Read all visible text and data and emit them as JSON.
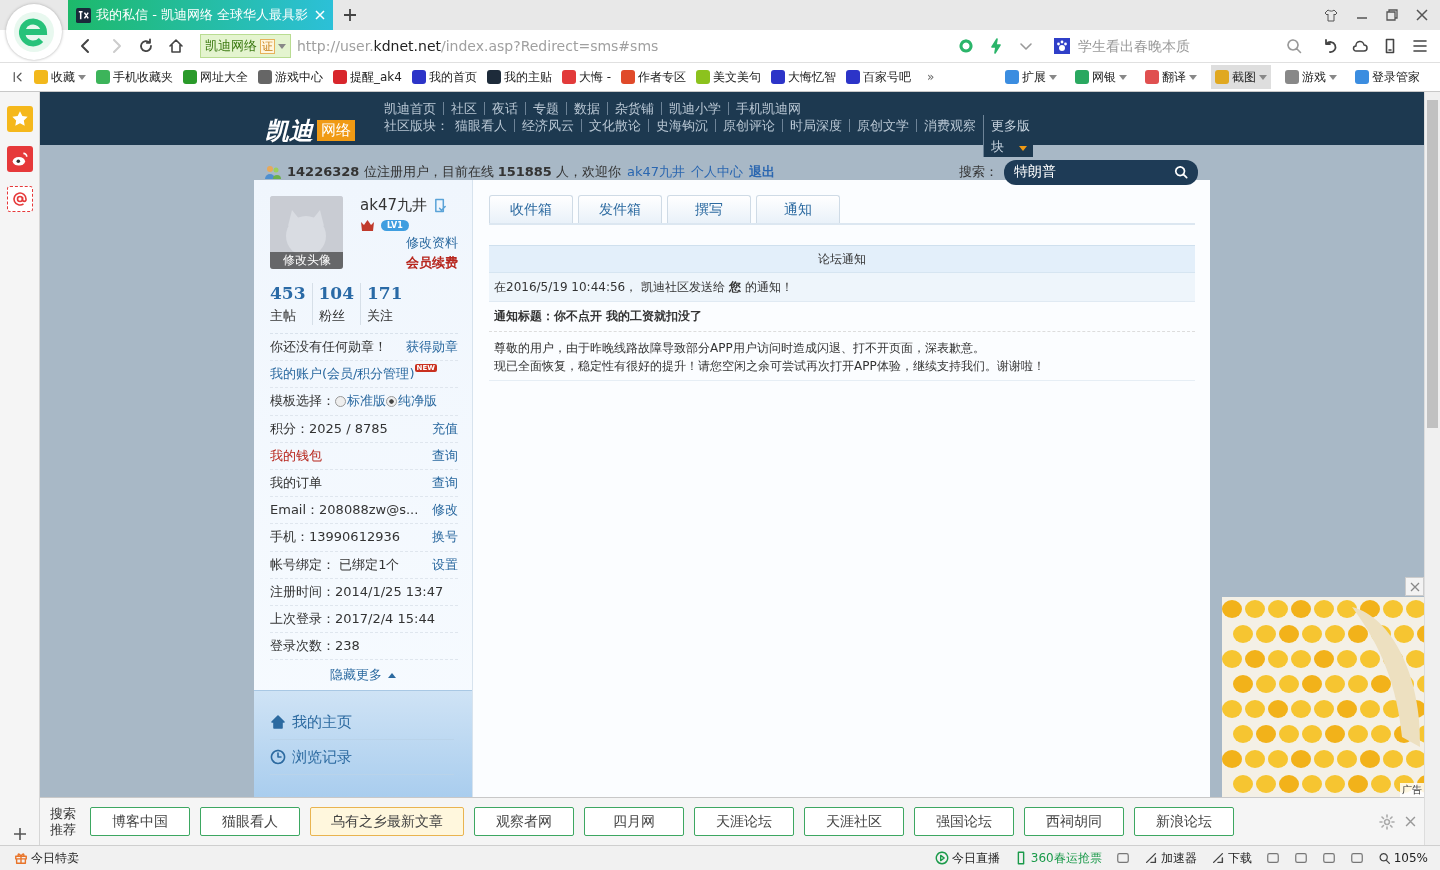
{
  "browser": {
    "tab": {
      "title": "我的私信 - 凯迪网络 全球华人最具影"
    },
    "address": {
      "site": "凯迪网络",
      "cert": "证",
      "url_prefix": "http://user.",
      "url_host": "kdnet.net",
      "url_path": "/index.asp?Redirect=sms#sms"
    },
    "search": {
      "placeholder": "学生看出春晚本质"
    },
    "bookmarks": [
      {
        "label": "收藏",
        "color": "#f2b81c",
        "caret": true
      },
      {
        "label": "手机收藏夹",
        "color": "#3cb45a",
        "caret": false
      },
      {
        "label": "网址大全",
        "color": "#2a9a2a",
        "caret": false
      },
      {
        "label": "游戏中心",
        "color": "#666666",
        "caret": false
      },
      {
        "label": "提醒_ak4",
        "color": "#d8262c",
        "caret": false
      },
      {
        "label": "我的首页",
        "color": "#2c34c8",
        "caret": false
      },
      {
        "label": "我的主贴",
        "color": "#1d2b3a",
        "caret": false
      },
      {
        "label": "大悔 -",
        "color": "#e23a3a",
        "caret": false
      },
      {
        "label": "作者专区",
        "color": "#e04a2a",
        "caret": false
      },
      {
        "label": "美文美句",
        "color": "#8cc21e",
        "caret": false
      },
      {
        "label": "大悔忆智",
        "color": "#2c34c8",
        "caret": false
      },
      {
        "label": "百家号吧",
        "color": "#2c34c8",
        "caret": false
      }
    ],
    "bookmarks_more": "»",
    "tools": [
      {
        "label": "扩展",
        "color": "#3b8de0",
        "caret": true,
        "selected": false
      },
      {
        "label": "网银",
        "color": "#2aa860",
        "caret": true,
        "selected": false
      },
      {
        "label": "翻译",
        "color": "#e05050",
        "caret": true,
        "selected": false
      },
      {
        "label": "截图",
        "color": "#e0a820",
        "caret": true,
        "selected": true
      },
      {
        "label": "游戏",
        "color": "#888888",
        "caret": true,
        "selected": false
      },
      {
        "label": "登录管家",
        "color": "#3b8de0",
        "caret": false,
        "selected": false
      }
    ]
  },
  "site": {
    "logo": {
      "name": "凯迪",
      "tag": "网络"
    },
    "nav": [
      "凯迪首页",
      "社区",
      "夜话",
      "专题",
      "数据",
      "杂货铺",
      "凯迪小学",
      "手机凯迪网"
    ],
    "boards_label": "社区版块：",
    "boards": [
      "猫眼看人",
      "经济风云",
      "文化散论",
      "史海钩沉",
      "原创评论",
      "时局深度",
      "原创文学",
      "消费观察"
    ],
    "boards_more": "更多版块",
    "stats": "**14226328** 位注册用户，目前在线 **151885** 人，欢迎你",
    "user_links": [
      {
        "label": "ak47九井",
        "kind": "link"
      },
      {
        "label": "个人中心",
        "kind": "link"
      },
      {
        "label": "退出",
        "kind": "strong"
      }
    ],
    "search": {
      "label": "搜索：",
      "value": "特朗普"
    }
  },
  "profile": {
    "avatar_label": "修改头像",
    "name": "ak47九井",
    "level": "LV1",
    "edit": "修改资料",
    "renew": "会员续费",
    "counts": [
      {
        "value": "453",
        "label": "主帖"
      },
      {
        "value": "104",
        "label": "粉丝"
      },
      {
        "value": "171",
        "label": "关注"
      }
    ],
    "rows": [
      {
        "kind": "info",
        "text": "你还没有任何勋章！",
        "action": "获得勋章"
      },
      {
        "kind": "account",
        "text": "我的账户(会员/积分管理)",
        "badge": "NEW"
      },
      {
        "kind": "radio",
        "text": "模板选择：",
        "options": [
          {
            "label": "标准版",
            "selected": false
          },
          {
            "label": "纯净版",
            "selected": true
          }
        ]
      },
      {
        "kind": "info",
        "text": "积分：2025 / 8785",
        "action": "充值"
      },
      {
        "kind": "alert",
        "text": "我的钱包",
        "action": "查询"
      },
      {
        "kind": "info",
        "text": "我的订单",
        "action": "查询"
      },
      {
        "kind": "info",
        "text": "Email：208088zw@s...",
        "action": "修改"
      },
      {
        "kind": "info",
        "text": "手机：13990612936",
        "action": "换号"
      },
      {
        "kind": "info",
        "text": "帐号绑定：  已绑定1个",
        "action": "设置"
      },
      {
        "kind": "info",
        "text": "注册时间：2014/1/25 13:47"
      },
      {
        "kind": "info",
        "text": "上次登录：2017/2/4 15:44"
      },
      {
        "kind": "info",
        "text": "登录次数：238"
      }
    ],
    "toggle": "隐藏更多",
    "menu": [
      {
        "kind": "home",
        "label": "我的主页"
      },
      {
        "kind": "history",
        "label": "浏览记录"
      }
    ]
  },
  "messages": {
    "tabs": [
      "收件箱",
      "发件箱",
      "撰写",
      "通知"
    ],
    "table": {
      "heading": "论坛通知",
      "meta": "在2016/5/19 10:44:56， 凯迪社区发送给 **您** 的通知！",
      "title": "通知标题：你不点开 我的工资就扣没了",
      "body": [
        "尊敬的用户，由于昨晚线路故障导致部分APP用户访问时造成闪退、打不开页面，深表歉意。",
        "现已全面恢复，稳定性有很好的提升！请您空闲之余可尝试再次打开APP体验，继续支持我们。谢谢啦！"
      ]
    }
  },
  "ad": {
    "label": "广告"
  },
  "recommend": {
    "label": "搜索推荐",
    "items": [
      {
        "label": "博客中国",
        "selected": false
      },
      {
        "label": "猫眼看人",
        "selected": false
      },
      {
        "label": "乌有之乡最新文章",
        "selected": true
      },
      {
        "label": "观察者网",
        "selected": false
      },
      {
        "label": "四月网",
        "selected": false
      },
      {
        "label": "天涯论坛",
        "selected": false
      },
      {
        "label": "天涯社区",
        "selected": false
      },
      {
        "label": "强国论坛",
        "selected": false
      },
      {
        "label": "西祠胡同",
        "selected": false
      },
      {
        "label": "新浪论坛",
        "selected": false
      }
    ]
  },
  "status": {
    "left": "今日特卖",
    "items": [
      {
        "kind": "live",
        "label": "今日直播"
      },
      {
        "kind": "promo",
        "label": "360春运抢票"
      },
      {
        "kind": "icon"
      },
      {
        "kind": "tool",
        "label": "加速器"
      },
      {
        "kind": "tool",
        "label": "下载"
      },
      {
        "kind": "icon"
      },
      {
        "kind": "icon"
      },
      {
        "kind": "icon"
      },
      {
        "kind": "icon"
      },
      {
        "kind": "zoom",
        "label": "105%"
      }
    ]
  }
}
